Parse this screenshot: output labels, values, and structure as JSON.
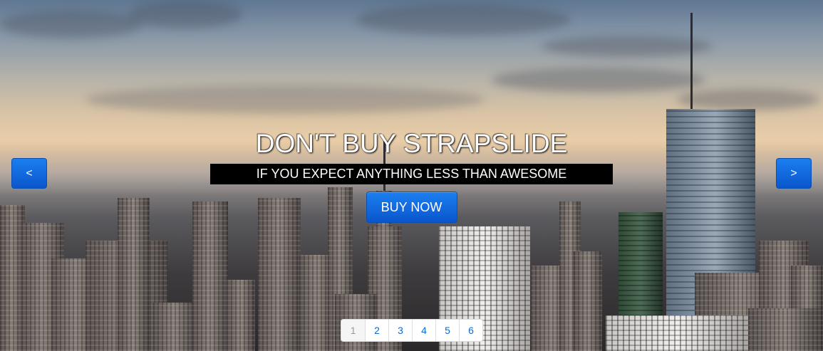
{
  "slide": {
    "headline": "DON'T BUY STRAPSLIDE",
    "subline": "IF YOU EXPECT ANYTHING LESS THAN AWESOME",
    "cta_label": "BUY NOW"
  },
  "controls": {
    "prev_label": "<",
    "next_label": ">"
  },
  "pagination": {
    "active": "1",
    "pages": [
      "1",
      "2",
      "3",
      "4",
      "5",
      "6"
    ]
  },
  "colors": {
    "button_blue": "#0a6ad6",
    "subline_bg": "#000000"
  },
  "icons": {
    "prev": "chevron-left",
    "next": "chevron-right"
  }
}
